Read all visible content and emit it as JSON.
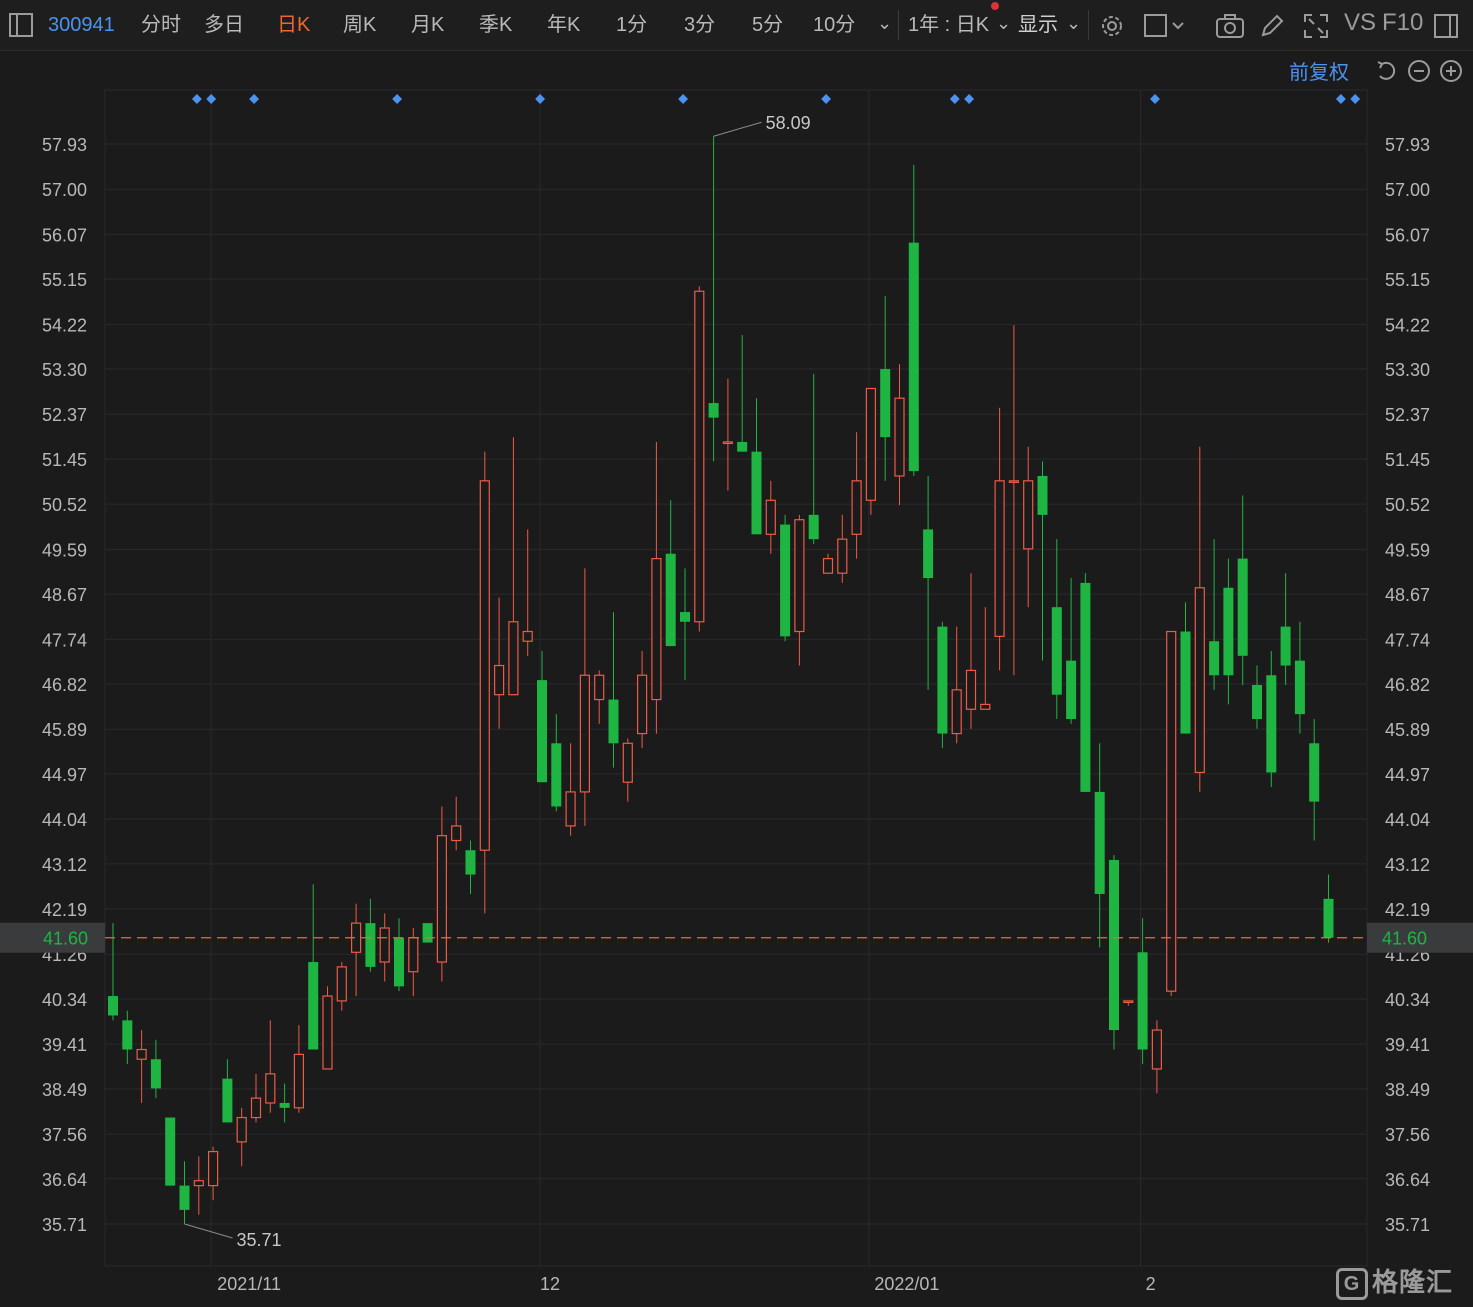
{
  "toolbar": {
    "code": "300941",
    "tabs": [
      {
        "label": "分时",
        "active": false
      },
      {
        "label": "多日",
        "active": false
      },
      {
        "label": "日K",
        "active": true
      },
      {
        "label": "周K",
        "active": false
      },
      {
        "label": "月K",
        "active": false
      },
      {
        "label": "季K",
        "active": false
      },
      {
        "label": "年K",
        "active": false
      },
      {
        "label": "1分",
        "active": false
      },
      {
        "label": "3分",
        "active": false
      },
      {
        "label": "5分",
        "active": false
      },
      {
        "label": "10分",
        "active": false
      }
    ],
    "period_select": "1年 : 日K",
    "display_select": "显示",
    "vs_label": "VS",
    "f10_label": "F10",
    "adjust_label": "前复权"
  },
  "colors": {
    "up": "#ee5a46",
    "down": "#1fb543",
    "accent": "#4b93f0",
    "last_price_line": "#e86c3a",
    "background": "#1b1b1c"
  },
  "chart_data": {
    "type": "candlestick",
    "x_labels": [
      {
        "label": "2021/11",
        "index": 7
      },
      {
        "label": "12",
        "index": 30
      },
      {
        "label": "2022/01",
        "index": 53
      },
      {
        "label": "2",
        "index": 72
      }
    ],
    "y_ticks": [
      35.71,
      36.64,
      37.56,
      38.49,
      39.41,
      40.34,
      41.26,
      42.19,
      43.12,
      44.04,
      44.97,
      45.89,
      46.82,
      47.74,
      48.67,
      49.59,
      50.52,
      51.45,
      52.37,
      53.3,
      54.22,
      55.15,
      56.07,
      57.0,
      57.93
    ],
    "ylim": [
      35.2,
      58.9
    ],
    "last_price": 41.6,
    "last_price_label": "41.60",
    "max_label": "58.09",
    "min_label": "35.71",
    "max_index": 42,
    "min_index": 5,
    "event_marker_indices": [
      3,
      4,
      7,
      17,
      27,
      37,
      47,
      56,
      57,
      70,
      83,
      84
    ],
    "candles": [
      {
        "o": 40.4,
        "h": 41.9,
        "l": 39.9,
        "c": 40.0
      },
      {
        "o": 39.9,
        "h": 40.1,
        "l": 39.0,
        "c": 39.3
      },
      {
        "o": 39.1,
        "h": 39.7,
        "l": 38.2,
        "c": 39.3
      },
      {
        "o": 39.1,
        "h": 39.5,
        "l": 38.3,
        "c": 38.5
      },
      {
        "o": 37.9,
        "h": 37.9,
        "l": 36.5,
        "c": 36.5
      },
      {
        "o": 36.5,
        "h": 37.0,
        "l": 35.71,
        "c": 36.0
      },
      {
        "o": 36.5,
        "h": 37.1,
        "l": 35.9,
        "c": 36.6
      },
      {
        "o": 36.5,
        "h": 37.3,
        "l": 36.2,
        "c": 37.2
      },
      {
        "o": 38.7,
        "h": 39.1,
        "l": 37.8,
        "c": 37.8
      },
      {
        "o": 37.4,
        "h": 38.1,
        "l": 36.9,
        "c": 37.9
      },
      {
        "o": 37.9,
        "h": 38.8,
        "l": 37.8,
        "c": 38.3
      },
      {
        "o": 38.2,
        "h": 39.9,
        "l": 38.0,
        "c": 38.8
      },
      {
        "o": 38.2,
        "h": 38.6,
        "l": 37.8,
        "c": 38.1
      },
      {
        "o": 38.1,
        "h": 39.8,
        "l": 38.0,
        "c": 39.2
      },
      {
        "o": 41.1,
        "h": 42.7,
        "l": 39.3,
        "c": 39.3
      },
      {
        "o": 38.9,
        "h": 40.6,
        "l": 38.9,
        "c": 40.4
      },
      {
        "o": 40.3,
        "h": 41.1,
        "l": 40.1,
        "c": 41.0
      },
      {
        "o": 41.3,
        "h": 42.3,
        "l": 40.4,
        "c": 41.9
      },
      {
        "o": 41.9,
        "h": 42.4,
        "l": 40.9,
        "c": 41.0
      },
      {
        "o": 41.1,
        "h": 42.1,
        "l": 40.7,
        "c": 41.8
      },
      {
        "o": 41.6,
        "h": 42.0,
        "l": 40.5,
        "c": 40.6
      },
      {
        "o": 40.9,
        "h": 41.8,
        "l": 40.4,
        "c": 41.6
      },
      {
        "o": 41.9,
        "h": 41.9,
        "l": 41.5,
        "c": 41.5
      },
      {
        "o": 41.1,
        "h": 44.3,
        "l": 40.7,
        "c": 43.7
      },
      {
        "o": 43.6,
        "h": 44.5,
        "l": 43.4,
        "c": 43.9
      },
      {
        "o": 43.4,
        "h": 43.6,
        "l": 42.5,
        "c": 42.9
      },
      {
        "o": 43.4,
        "h": 51.6,
        "l": 42.1,
        "c": 51.0
      },
      {
        "o": 46.6,
        "h": 48.6,
        "l": 45.9,
        "c": 47.2
      },
      {
        "o": 46.6,
        "h": 51.9,
        "l": 46.6,
        "c": 48.1
      },
      {
        "o": 47.7,
        "h": 50.0,
        "l": 47.4,
        "c": 47.9
      },
      {
        "o": 46.9,
        "h": 47.5,
        "l": 44.8,
        "c": 44.8
      },
      {
        "o": 45.6,
        "h": 46.2,
        "l": 44.2,
        "c": 44.3
      },
      {
        "o": 43.9,
        "h": 45.6,
        "l": 43.7,
        "c": 44.6
      },
      {
        "o": 44.6,
        "h": 49.2,
        "l": 43.9,
        "c": 47.0
      },
      {
        "o": 46.5,
        "h": 47.1,
        "l": 46.0,
        "c": 47.0
      },
      {
        "o": 46.5,
        "h": 48.3,
        "l": 45.1,
        "c": 45.6
      },
      {
        "o": 44.8,
        "h": 45.7,
        "l": 44.4,
        "c": 45.6
      },
      {
        "o": 45.8,
        "h": 47.5,
        "l": 45.5,
        "c": 47.0
      },
      {
        "o": 46.5,
        "h": 51.8,
        "l": 45.8,
        "c": 49.4
      },
      {
        "o": 49.5,
        "h": 50.6,
        "l": 47.6,
        "c": 47.6
      },
      {
        "o": 48.3,
        "h": 49.2,
        "l": 46.9,
        "c": 48.1
      },
      {
        "o": 48.1,
        "h": 55.0,
        "l": 47.9,
        "c": 54.9
      },
      {
        "o": 52.6,
        "h": 58.09,
        "l": 51.4,
        "c": 52.3
      },
      {
        "o": 51.8,
        "h": 53.1,
        "l": 50.8,
        "c": 51.8
      },
      {
        "o": 51.8,
        "h": 54.0,
        "l": 51.6,
        "c": 51.6
      },
      {
        "o": 51.6,
        "h": 52.7,
        "l": 49.9,
        "c": 49.9
      },
      {
        "o": 49.9,
        "h": 51.0,
        "l": 49.5,
        "c": 50.6
      },
      {
        "o": 50.1,
        "h": 50.3,
        "l": 47.7,
        "c": 47.8
      },
      {
        "o": 47.9,
        "h": 50.3,
        "l": 47.2,
        "c": 50.2
      },
      {
        "o": 50.3,
        "h": 53.2,
        "l": 49.7,
        "c": 49.8
      },
      {
        "o": 49.1,
        "h": 49.5,
        "l": 49.1,
        "c": 49.4
      },
      {
        "o": 49.1,
        "h": 50.3,
        "l": 48.9,
        "c": 49.8
      },
      {
        "o": 49.9,
        "h": 52.0,
        "l": 49.4,
        "c": 51.0
      },
      {
        "o": 50.6,
        "h": 52.6,
        "l": 50.3,
        "c": 52.9
      },
      {
        "o": 53.3,
        "h": 54.8,
        "l": 51.0,
        "c": 51.9
      },
      {
        "o": 51.1,
        "h": 53.4,
        "l": 50.5,
        "c": 52.7
      },
      {
        "o": 55.9,
        "h": 57.5,
        "l": 51.1,
        "c": 51.2
      },
      {
        "o": 50.0,
        "h": 51.1,
        "l": 46.7,
        "c": 49.0
      },
      {
        "o": 48.0,
        "h": 48.1,
        "l": 45.5,
        "c": 45.8
      },
      {
        "o": 45.8,
        "h": 48.0,
        "l": 45.6,
        "c": 46.7
      },
      {
        "o": 46.3,
        "h": 49.1,
        "l": 45.9,
        "c": 47.1
      },
      {
        "o": 46.3,
        "h": 48.4,
        "l": 46.3,
        "c": 46.4
      },
      {
        "o": 47.8,
        "h": 52.5,
        "l": 47.1,
        "c": 51.0
      },
      {
        "o": 51.0,
        "h": 54.2,
        "l": 47.0,
        "c": 51.0
      },
      {
        "o": 49.6,
        "h": 51.7,
        "l": 48.4,
        "c": 51.0
      },
      {
        "o": 51.1,
        "h": 51.4,
        "l": 47.3,
        "c": 50.3
      },
      {
        "o": 48.4,
        "h": 49.8,
        "l": 46.1,
        "c": 46.6
      },
      {
        "o": 47.3,
        "h": 49.0,
        "l": 46.0,
        "c": 46.1
      },
      {
        "o": 48.9,
        "h": 49.1,
        "l": 44.6,
        "c": 44.6
      },
      {
        "o": 44.6,
        "h": 45.6,
        "l": 41.4,
        "c": 42.5
      },
      {
        "o": 43.2,
        "h": 43.3,
        "l": 39.3,
        "c": 39.7
      },
      {
        "o": 40.3,
        "h": 40.3,
        "l": 40.2,
        "c": 40.3
      },
      {
        "o": 41.3,
        "h": 42.0,
        "l": 39.0,
        "c": 39.3
      },
      {
        "o": 38.9,
        "h": 39.9,
        "l": 38.4,
        "c": 39.7
      },
      {
        "o": 40.5,
        "h": 47.9,
        "l": 40.4,
        "c": 47.9
      },
      {
        "o": 47.9,
        "h": 48.5,
        "l": 45.8,
        "c": 45.8
      },
      {
        "o": 45.0,
        "h": 51.7,
        "l": 44.6,
        "c": 48.8
      },
      {
        "o": 47.7,
        "h": 49.8,
        "l": 46.7,
        "c": 47.0
      },
      {
        "o": 48.8,
        "h": 49.4,
        "l": 46.4,
        "c": 47.0
      },
      {
        "o": 49.4,
        "h": 50.7,
        "l": 46.8,
        "c": 47.4
      },
      {
        "o": 46.8,
        "h": 47.2,
        "l": 45.9,
        "c": 46.1
      },
      {
        "o": 47.0,
        "h": 47.5,
        "l": 44.7,
        "c": 45.0
      },
      {
        "o": 48.0,
        "h": 49.1,
        "l": 46.8,
        "c": 47.2
      },
      {
        "o": 47.3,
        "h": 48.1,
        "l": 45.8,
        "c": 46.2
      },
      {
        "o": 45.6,
        "h": 46.1,
        "l": 43.6,
        "c": 44.4
      },
      {
        "o": 42.4,
        "h": 42.9,
        "l": 41.5,
        "c": 41.6
      }
    ]
  }
}
